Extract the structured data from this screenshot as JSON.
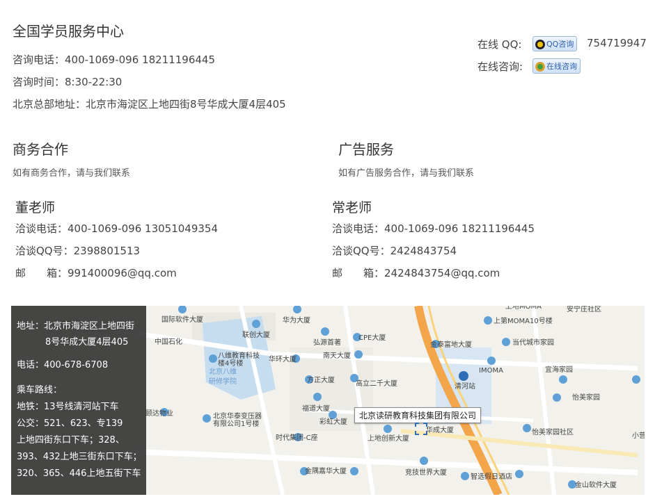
{
  "center": {
    "title": "全国学员服务中心",
    "phone": "咨询电话：400-1069-096  18211196445",
    "hours": "咨询时间：8:30-22:30",
    "address": "北京总部地址：北京市海淀区上地四街8号华成大厦4层405"
  },
  "contact": {
    "qq_label": "在线 QQ:",
    "qq_button": "QQ咨询",
    "qq_number": "754719947",
    "online_label": "在线咨询:",
    "online_button": "在线咨询"
  },
  "business": {
    "title": "商务合作",
    "desc": "如有商务合作，请与我们联系",
    "person": "董老师",
    "phone": "洽谈电话：400-1069-096  13051049354",
    "qq": "洽谈QQ号：2398801513",
    "email_label": "邮　　箱：",
    "email": "991400096@qq.com"
  },
  "ads": {
    "title": "广告服务",
    "desc": "如有广告服务合作，请与我们联系",
    "person": "常老师",
    "phone": "洽谈电话：400-1069-096  18211196445",
    "qq": "洽谈QQ号：2424843754",
    "email_label": "邮　　箱：",
    "email": "2424843754@qq.com"
  },
  "map": {
    "overlay": {
      "addr1": "地址：北京市海淀区上地四街",
      "addr2": "8号华成大厦4层405",
      "tel": "电话：400-678-6708",
      "route": "乘车路线：",
      "subway": "地铁：13号线清河站下车",
      "bus1": "公交：521、623、专139",
      "bus2": "上地四街东口下车；328、",
      "bus3": "393、432上地三街东口下车；",
      "bus4": "320、365、446上地五街下车"
    },
    "marker_label": "北京读研教育科技集团有限公司",
    "places": [
      "国际软件大厦",
      "华为大厦",
      "联创大厦",
      "弘源首著",
      "CPE大厦",
      "南天大厦",
      "华环大厦",
      "八维教育科技楼4号楼",
      "北京八维研修学院",
      "方正大厦",
      "高立二千大厦",
      "福道大厦",
      "彩虹大厦",
      "北京华泰变压器有限公司1号楼",
      "时代集团-C座",
      "上地创新大厦",
      "华成大厦",
      "金隅嘉华大厦",
      "竞技世界大厦",
      "智选假日酒店",
      "金泰富地大厦",
      "当代城市家园",
      "清河站",
      "IMOMA",
      "上第MOMA10号楼",
      "宜海家园",
      "怡美家园",
      "怡美家园社区",
      "中国石化",
      "金山软件大厦",
      "安宁庄社区",
      "颐达物业",
      "上地MOMA",
      "小营"
    ]
  }
}
